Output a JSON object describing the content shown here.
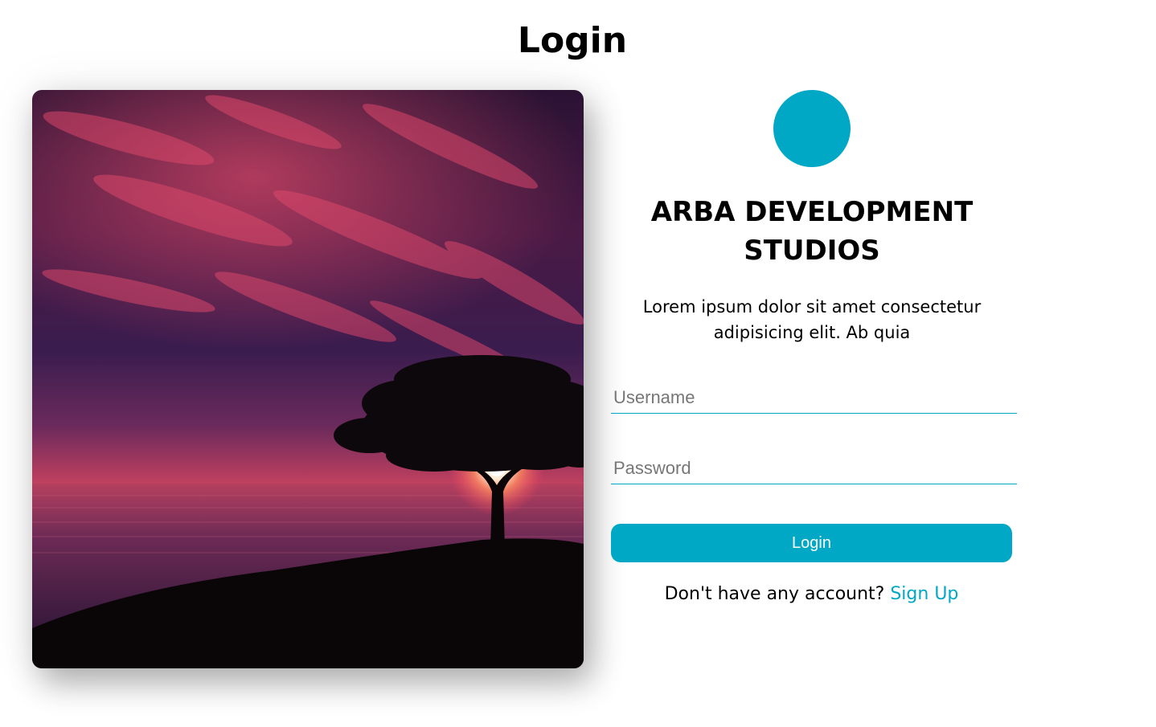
{
  "page": {
    "title": "Login"
  },
  "brand": {
    "name": "ARBA DEVELOPMENT STUDIOS",
    "tagline": "Lorem ipsum dolor sit amet consectetur adipisicing elit. Ab quia",
    "accent_color": "#00a8c6"
  },
  "form": {
    "username_placeholder": "Username",
    "password_placeholder": "Password",
    "login_label": "Login",
    "signup_prompt": "Don't have any account?",
    "signup_link_label": "Sign Up"
  },
  "hero_image": {
    "subject": "tree-sunset-over-sea"
  }
}
